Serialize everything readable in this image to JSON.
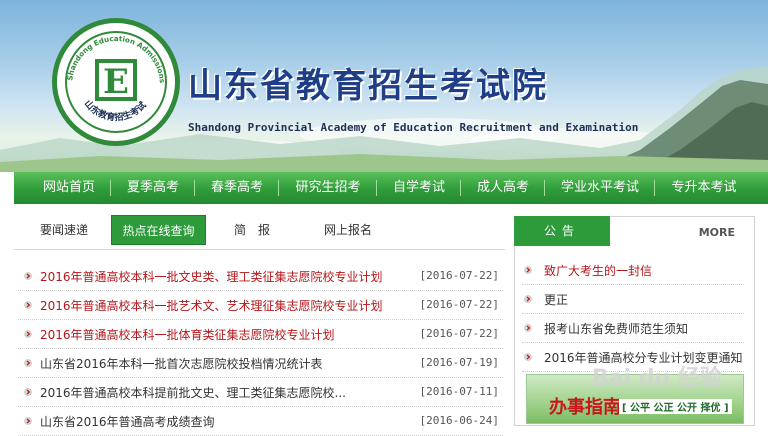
{
  "site": {
    "title": "山东省教育招生考试院",
    "subtitle": "Shandong Provincial Academy of Education  Recruitment and Examination",
    "emblem_outer_text": "Shandong Education Admissions & Examinations",
    "emblem_inner_text": "山东教育招生考试",
    "emblem_letter": "E"
  },
  "nav": {
    "items": [
      "网站首页",
      "夏季高考",
      "春季高考",
      "研究生招考",
      "自学考试",
      "成人高考",
      "学业水平考试",
      "专升本考试"
    ]
  },
  "tabs": {
    "items": [
      "要闻速递",
      "热点在线查询",
      "简　报",
      "网上报名"
    ],
    "active_index": 1
  },
  "news": {
    "items": [
      {
        "title": "2016年普通高校本科一批文史类、理工类征集志愿院校专业计划",
        "date": "[2016-07-22]",
        "highlight": true
      },
      {
        "title": "2016年普通高校本科一批艺术文、艺术理征集志愿院校专业计划",
        "date": "[2016-07-22]",
        "highlight": true
      },
      {
        "title": "2016年普通高校本科一批体育类征集志愿院校专业计划",
        "date": "[2016-07-22]",
        "highlight": true
      },
      {
        "title": "山东省2016年本科一批首次志愿院校投档情况统计表",
        "date": "[2016-07-19]",
        "highlight": false
      },
      {
        "title": "2016年普通高校本科提前批文史、理工类征集志愿院校...",
        "date": "[2016-07-11]",
        "highlight": false
      },
      {
        "title": "山东省2016年普通高考成绩查询",
        "date": "[2016-06-24]",
        "highlight": false
      }
    ]
  },
  "notice": {
    "tab_label": "公告",
    "more_label": "MORE",
    "items": [
      {
        "title": "致广大考生的一封信",
        "highlight": true
      },
      {
        "title": "更正",
        "highlight": false
      },
      {
        "title": "报考山东省免费师范生须知",
        "highlight": false
      },
      {
        "title": "2016年普通高校分专业计划变更通知",
        "highlight": false
      }
    ]
  },
  "service_banner": {
    "title": "办事指南",
    "slogan": "[ 公平  公正  公开  择优 ]"
  },
  "watermark": "Bai du 经验",
  "colors": {
    "green": "#2e9b3b",
    "nav_green": "#2f9c3a",
    "title_blue": "#1e3f87",
    "red_link": "#b5161a"
  }
}
